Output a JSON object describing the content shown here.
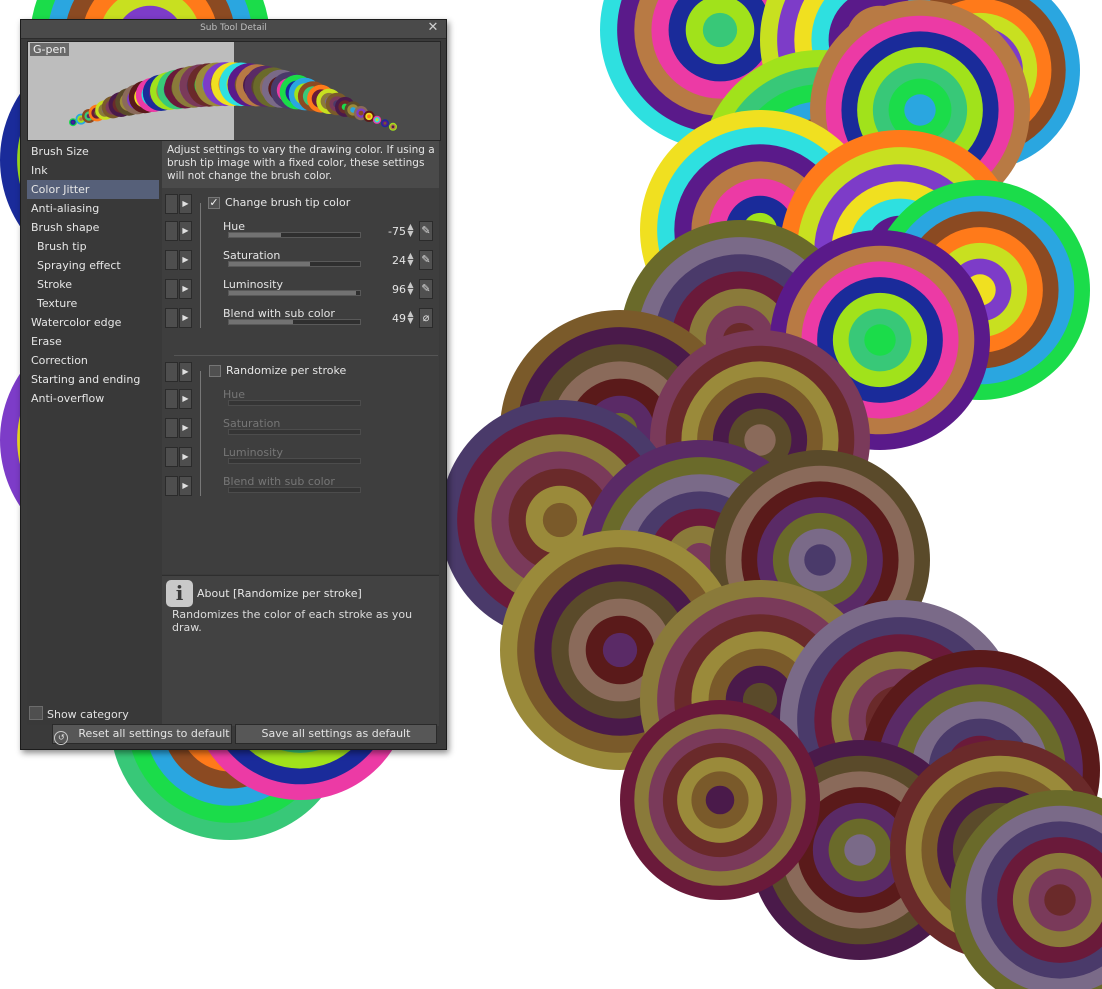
{
  "window": {
    "title": "Sub Tool Detail",
    "close_glyph": "✕"
  },
  "preview": {
    "tool_name": "G-pen"
  },
  "sidebar": {
    "items": [
      {
        "label": "Brush Size"
      },
      {
        "label": "Ink"
      },
      {
        "label": "Color Jitter",
        "active": true
      },
      {
        "label": "Anti-aliasing"
      },
      {
        "label": "Brush shape"
      },
      {
        "label": "Brush tip",
        "sub": true
      },
      {
        "label": "Spraying effect",
        "sub": true
      },
      {
        "label": "Stroke",
        "sub": true
      },
      {
        "label": "Texture",
        "sub": true
      },
      {
        "label": "Watercolor edge"
      },
      {
        "label": "Erase"
      },
      {
        "label": "Correction"
      },
      {
        "label": "Starting and ending"
      },
      {
        "label": "Anti-overflow"
      }
    ],
    "show_category": "Show category"
  },
  "panel": {
    "description": "Adjust settings to vary the drawing color. If using a brush tip image with a fixed color, these settings will not change the brush color.",
    "change_brush_tip_color": {
      "label": "Change brush tip color",
      "checked": true
    },
    "params": [
      {
        "label": "Hue",
        "value": "-75",
        "fill_fraction": 0.4,
        "pressure_icon": "pressure-pen-icon"
      },
      {
        "label": "Saturation",
        "value": "24",
        "fill_fraction": 0.62,
        "pressure_icon": "pressure-pen-icon"
      },
      {
        "label": "Luminosity",
        "value": "96",
        "fill_fraction": 0.97,
        "pressure_icon": "pressure-pen-icon"
      },
      {
        "label": "Blend with sub color",
        "value": "49",
        "fill_fraction": 0.49,
        "pressure_icon": "disabled-icon"
      }
    ],
    "randomize_per_stroke": {
      "label": "Randomize per stroke",
      "checked": false
    },
    "random_params": [
      {
        "label": "Hue"
      },
      {
        "label": "Saturation"
      },
      {
        "label": "Luminosity"
      },
      {
        "label": "Blend with sub color"
      }
    ]
  },
  "about": {
    "title": "About [Randomize per stroke]",
    "text": "Randomizes the color of each stroke as you draw."
  },
  "buttons": {
    "reset": "Reset all settings to default",
    "save": "Save all settings as default"
  }
}
